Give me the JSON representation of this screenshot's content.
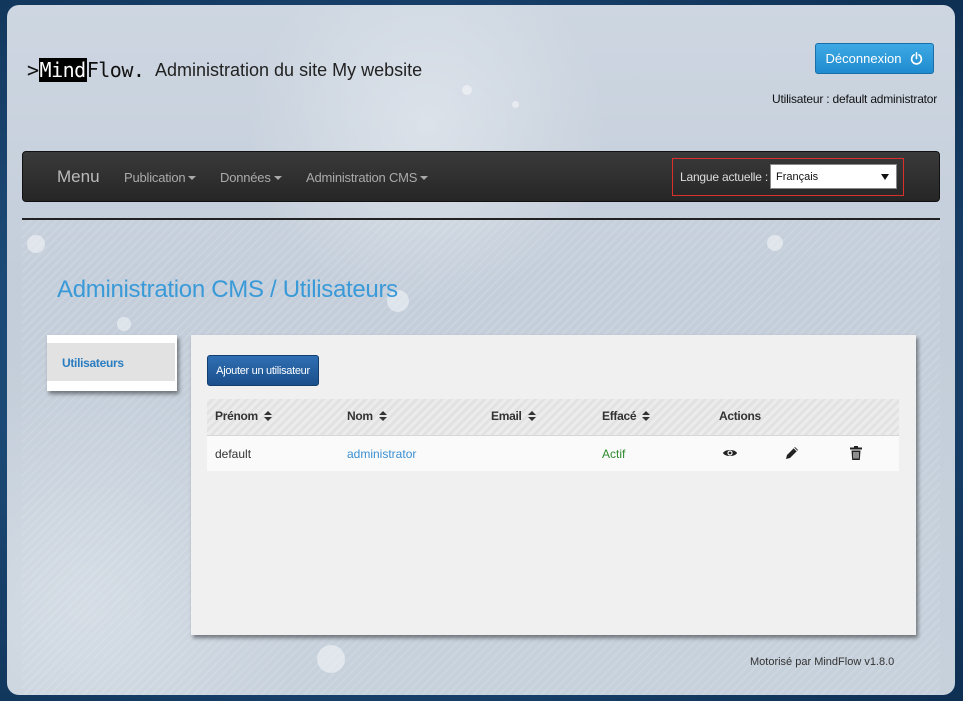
{
  "header": {
    "logo_prefix": ">",
    "logo_boxed": "Mind",
    "logo_rest": "Flow.",
    "site_title": "Administration du site My website",
    "logout_label": "Déconnexion",
    "user_line": "Utilisateur : default administrator"
  },
  "navbar": {
    "brand": "Menu",
    "items": [
      {
        "label": "Publication"
      },
      {
        "label": "Données"
      },
      {
        "label": "Administration CMS"
      }
    ],
    "language_label": "Langue actuelle :",
    "language_value": "Français"
  },
  "page": {
    "title": "Administration CMS / Utilisateurs"
  },
  "sidebar": {
    "items": [
      {
        "label": "Utilisateurs"
      }
    ]
  },
  "users": {
    "add_button": "Ajouter un utilisateur",
    "columns": [
      "Prénom",
      "Nom",
      "Email",
      "Effacé",
      "Actions"
    ],
    "rows": [
      {
        "prenom": "default",
        "nom": "administrator",
        "email": "",
        "efface": "Actif"
      }
    ]
  },
  "footer": {
    "text": "Motorisé par MindFlow v1.8.0"
  },
  "colors": {
    "accent": "#3a9ad8",
    "logout_button": "#2a9ad9",
    "add_button": "#1f5b9e",
    "status_active": "#2e8b2e",
    "lang_highlight": "#d9302c"
  }
}
